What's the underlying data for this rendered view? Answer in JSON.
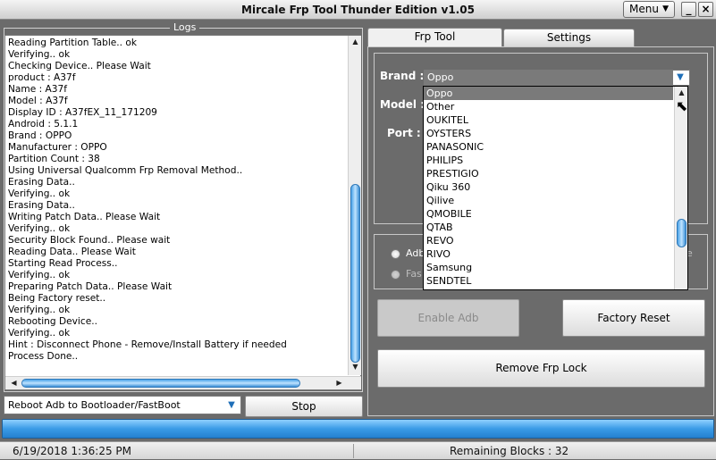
{
  "window": {
    "title": "Mircale Frp Tool Thunder Edition v1.05",
    "menu_label": "Menu",
    "minimize": "_",
    "close": "×"
  },
  "logs": {
    "caption": "Logs",
    "lines": [
      "Reading Partition Table.. ok",
      "Verifying.. ok",
      "Checking Device.. Please Wait",
      "product : A37f",
      "Name : A37f",
      "Model : A37f",
      "Display ID : A37fEX_11_171209",
      "Android : 5.1.1",
      "Brand : OPPO",
      "Manufacturer : OPPO",
      "Partition Count : 38",
      "Using Universal Qualcomm Frp Removal Method..",
      "Erasing Data..",
      "Verifying.. ok",
      "Erasing Data..",
      "Writing Patch Data.. Please Wait",
      "Verifying.. ok",
      "Security Block Found.. Please wait",
      "Reading Data.. Please Wait",
      "Starting Read Process..",
      "Verifying.. ok",
      "Preparing Patch Data.. Please Wait",
      "Being Factory reset..",
      "Verifying.. ok",
      "Rebooting Device..",
      "Verifying.. ok",
      "Hint : Disconnect Phone - Remove/Install Battery if needed",
      "Process Done.."
    ]
  },
  "boot_combo": {
    "value": "Reboot Adb to Bootloader/FastBoot"
  },
  "stop_label": "Stop",
  "tabs": {
    "frp": "Frp Tool",
    "settings": "Settings"
  },
  "frp": {
    "brand_label": "Brand :",
    "model_label": "Model :",
    "port_label": "Port :",
    "brand_value": "Oppo",
    "brand_options": [
      "Oppo",
      "Other",
      "OUKITEL",
      "OYSTERS",
      "PANASONIC",
      "PHILIPS",
      "PRESTIGIO",
      "Qiku 360",
      "Qilive",
      "QMOBILE",
      "QTAB",
      "REVO",
      "RIVO",
      "Samsung",
      "SENDTEL"
    ],
    "mode_adb": "Adb",
    "mode_fast": "Fas",
    "mode_right": "e",
    "enable_adb": "Enable Adb",
    "factory_reset": "Factory Reset",
    "remove_frp": "Remove Frp Lock"
  },
  "progress": {
    "value": 1.0
  },
  "status": {
    "datetime": "6/19/2018 1:36:25 PM",
    "remaining": "Remaining Blocks : 32"
  },
  "colors": {
    "panel_bg": "#6b6b6b",
    "accent": "#2f8fdc",
    "selection": "#7a7a7a"
  }
}
